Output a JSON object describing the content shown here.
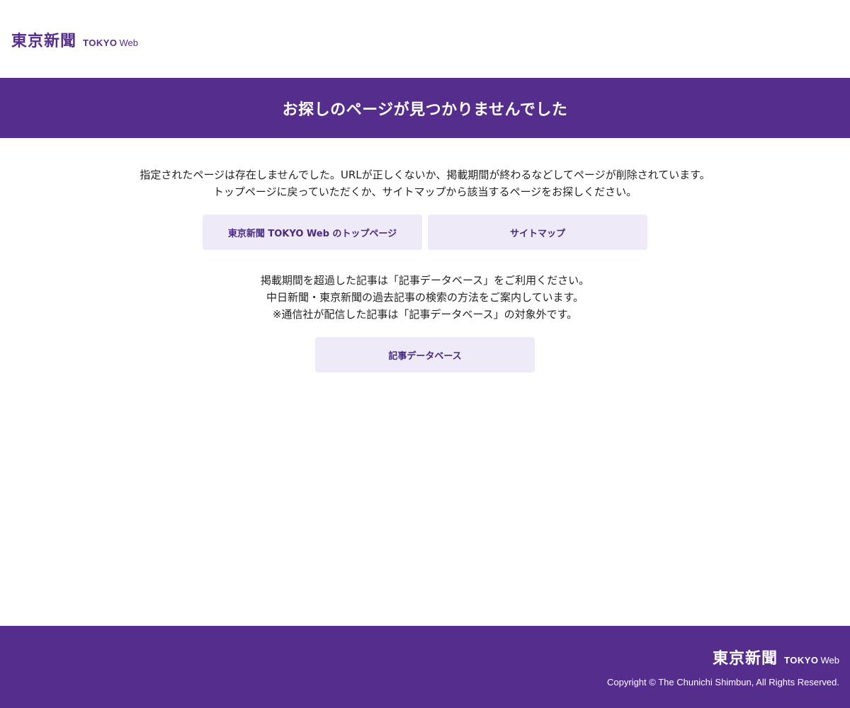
{
  "header": {
    "logo": {
      "kanji": "東京新聞",
      "tokyo": "TOKYO",
      "web": "Web"
    }
  },
  "title_band": {
    "heading": "お探しのページが見つかりませんでした"
  },
  "main": {
    "message_1": [
      "指定されたページは存在しませんでした。URLが正しくないか、掲載期間が終わるなどしてページが削除されています。",
      "トップページに戻っていただくか、サイトマップから該当するページをお探しください。"
    ],
    "buttons": {
      "top_page": "東京新聞 TOKYO Web のトップページ",
      "sitemap": "サイトマップ",
      "article_db": "記事データベース"
    },
    "message_2": [
      "掲載期間を超過した記事は「記事データベース」をご利用ください。",
      "中日新聞・東京新聞の過去記事の検索の方法をご案内しています。",
      "※通信社が配信した記事は「記事データベース」の対象外です。"
    ]
  },
  "footer": {
    "logo": {
      "kanji": "東京新聞",
      "tokyo": "TOKYO",
      "web": "Web"
    },
    "copyright": "Copyright © The Chunichi Shimbun, All Rights Reserved."
  },
  "colors": {
    "brand_purple": "#552d8c",
    "button_bg": "#eeeaf8",
    "button_text": "#4a2a84"
  }
}
